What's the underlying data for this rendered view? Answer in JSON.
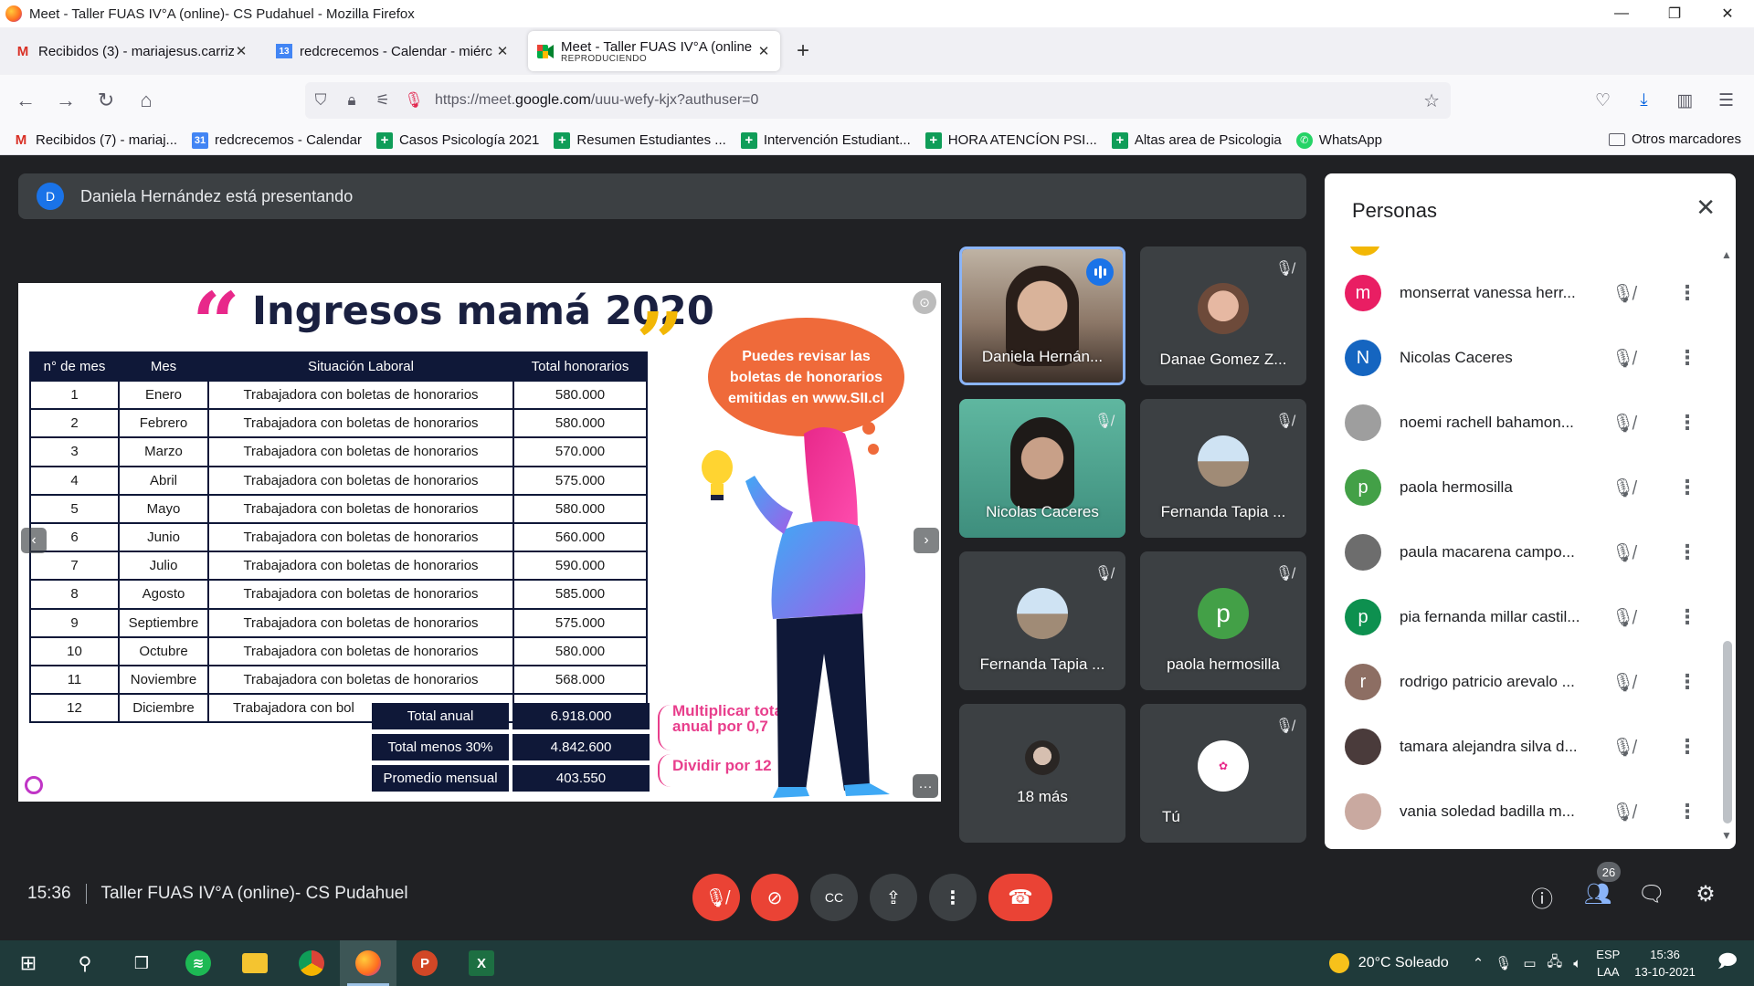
{
  "window": {
    "title": "Meet - Taller FUAS IV°A (online)- CS Pudahuel - Mozilla Firefox",
    "minimize": "—",
    "maximize": "❐",
    "close": "✕"
  },
  "tabs": [
    {
      "label": "Recibidos (3) - mariajesus.carriz",
      "icon": "gmail-icon",
      "close": "✕"
    },
    {
      "label": "redcrecemos - Calendar - miérc",
      "icon": "calendar-icon",
      "close": "✕"
    },
    {
      "label": "Meet - Taller FUAS IV°A (online",
      "sub": "REPRODUCIENDO",
      "icon": "meet-icon",
      "close": "✕"
    }
  ],
  "new_tab": "+",
  "url": {
    "prefix": "https://meet.",
    "domain": "google.com",
    "path": "/uuu-wefy-kjx?authuser=0"
  },
  "bookmarks": [
    {
      "label": "Recibidos (7) - mariaj...",
      "icon": "M"
    },
    {
      "label": "redcrecemos - Calendar",
      "icon": "31"
    },
    {
      "label": "Casos Psicología 2021",
      "icon": "+"
    },
    {
      "label": "Resumen Estudiantes ...",
      "icon": "+"
    },
    {
      "label": "Intervención Estudiant...",
      "icon": "+"
    },
    {
      "label": "HORA ATENCÍON PSI...",
      "icon": "+"
    },
    {
      "label": "Altas area de Psicologia",
      "icon": "+"
    },
    {
      "label": "WhatsApp",
      "icon": "✆"
    }
  ],
  "other_bookmarks": "Otros marcadores",
  "presenting": {
    "avatar": "D",
    "text": "Daniela Hernández está presentando"
  },
  "slide": {
    "title": "Ingresos mamá 2020",
    "headers": [
      "n° de mes",
      "Mes",
      "Situación Laboral",
      "Total honorarios"
    ],
    "rows": [
      [
        "1",
        "Enero",
        "Trabajadora con boletas de honorarios",
        "580.000"
      ],
      [
        "2",
        "Febrero",
        "Trabajadora con boletas de honorarios",
        "580.000"
      ],
      [
        "3",
        "Marzo",
        "Trabajadora con boletas de honorarios",
        "570.000"
      ],
      [
        "4",
        "Abril",
        "Trabajadora con boletas de honorarios",
        "575.000"
      ],
      [
        "5",
        "Mayo",
        "Trabajadora con boletas de honorarios",
        "580.000"
      ],
      [
        "6",
        "Junio",
        "Trabajadora con boletas de honorarios",
        "560.000"
      ],
      [
        "7",
        "Julio",
        "Trabajadora con boletas de honorarios",
        "590.000"
      ],
      [
        "8",
        "Agosto",
        "Trabajadora con boletas de honorarios",
        "585.000"
      ],
      [
        "9",
        "Septiembre",
        "Trabajadora con boletas de honorarios",
        "575.000"
      ],
      [
        "10",
        "Octubre",
        "Trabajadora con boletas de honorarios",
        "580.000"
      ],
      [
        "11",
        "Noviembre",
        "Trabajadora con boletas de honorarios",
        "568.000"
      ],
      [
        "12",
        "Diciembre",
        "Trabajadora con bol",
        ""
      ]
    ],
    "totals": [
      {
        "label": "Total anual",
        "value": "6.918.000"
      },
      {
        "label": "Total menos 30%",
        "value": "4.842.600"
      },
      {
        "label": "Promedio mensual",
        "value": "403.550"
      }
    ],
    "note1": "Multiplicar total anual por 0,7",
    "note2": "Dividir por 12",
    "bubble": "Puedes revisar las boletas de honorarios emitidas en www.SII.cl"
  },
  "tiles": [
    {
      "name": "Daniela Hernán...",
      "speaking": true
    },
    {
      "name": "Danae Gomez Z..."
    },
    {
      "name": "Nicolas Caceres"
    },
    {
      "name": "Fernanda Tapia ..."
    },
    {
      "name": "Fernanda Tapia ..."
    },
    {
      "name": "paola hermosilla",
      "initial": "p"
    },
    {
      "name": "18 más"
    },
    {
      "name": "Tú"
    }
  ],
  "people_panel": {
    "title": "Personas",
    "list": [
      {
        "name": "monserrat vanessa herr...",
        "initial": "m",
        "color": "#e91e63"
      },
      {
        "name": "Nicolas Caceres",
        "initial": "N",
        "color": "#1565c0"
      },
      {
        "name": "noemi rachell bahamon...",
        "initial": "",
        "color": "#9e9e9e"
      },
      {
        "name": "paola hermosilla",
        "initial": "p",
        "color": "#43a047"
      },
      {
        "name": "paula macarena campo...",
        "initial": "",
        "color": "#6d6d6d"
      },
      {
        "name": "pia fernanda millar castil...",
        "initial": "p",
        "color": "#0d904f"
      },
      {
        "name": "rodrigo patricio arevalo ...",
        "initial": "r",
        "color": "#8d6e63"
      },
      {
        "name": "tamara alejandra silva d...",
        "initial": "",
        "color": "#4a3b3b"
      },
      {
        "name": "vania soledad badilla m...",
        "initial": "",
        "color": "#c9a9a0"
      }
    ]
  },
  "controls": {
    "time": "15:36",
    "meeting": "Taller FUAS IV°A (online)- CS Pudahuel",
    "participants": "26"
  },
  "taskbar": {
    "weather": "20°C  Soleado",
    "lang1": "ESP",
    "lang2": "LAA",
    "time": "15:36",
    "date": "13-10-2021"
  }
}
